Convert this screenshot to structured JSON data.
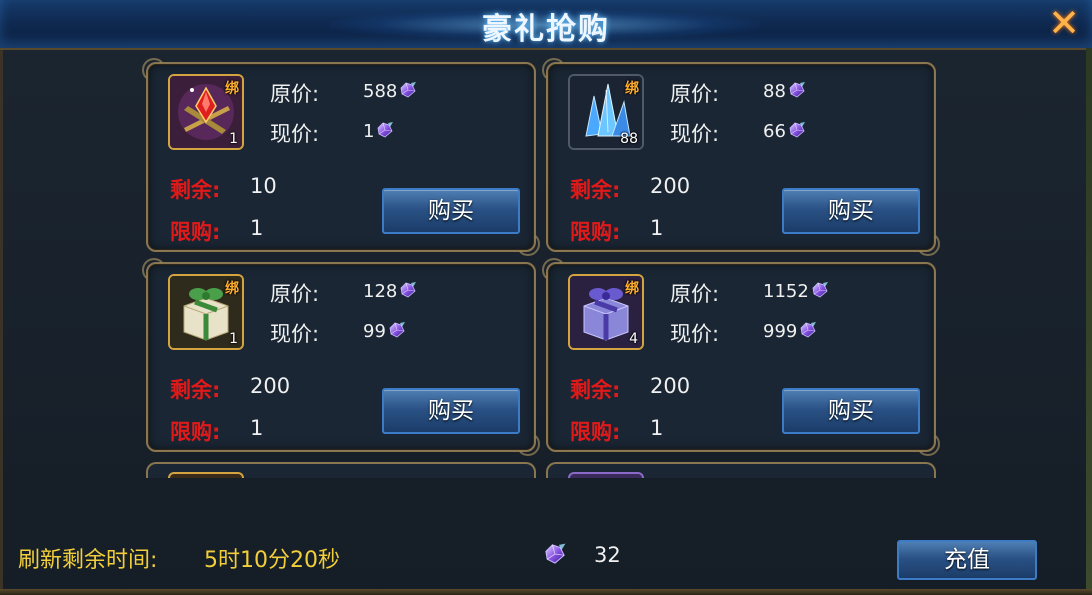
{
  "window": {
    "title": "豪礼抢购",
    "close_icon": "close-icon"
  },
  "labels": {
    "original_price": "原价:",
    "current_price": "现价:",
    "remaining": "剩余:",
    "limit": "限购:",
    "buy": "购买",
    "bind": "绑"
  },
  "items": [
    {
      "icon": "ruby-gem-icon",
      "qty": "1",
      "original_price": "588",
      "current_price": "1",
      "remaining": "10",
      "limit": "1"
    },
    {
      "icon": "blue-crystal-icon",
      "qty": "88",
      "original_price": "88",
      "current_price": "66",
      "remaining": "200",
      "limit": "1"
    },
    {
      "icon": "green-gift-box-icon",
      "qty": "1",
      "original_price": "128",
      "current_price": "99",
      "remaining": "200",
      "limit": "1"
    },
    {
      "icon": "purple-gift-box-icon",
      "qty": "4",
      "original_price": "1152",
      "current_price": "999",
      "remaining": "200",
      "limit": "1"
    }
  ],
  "footer": {
    "refresh_label": "刷新剩余时间:",
    "refresh_time": "5时10分20秒",
    "balance": "32",
    "recharge_label": "充值"
  },
  "colors": {
    "title_glow": "#6fc8ff",
    "accent_gold": "#f2cf3a",
    "stat_red": "#e01a1a",
    "button_blue": "#2a5286",
    "close_orange": "#ffb24a"
  }
}
